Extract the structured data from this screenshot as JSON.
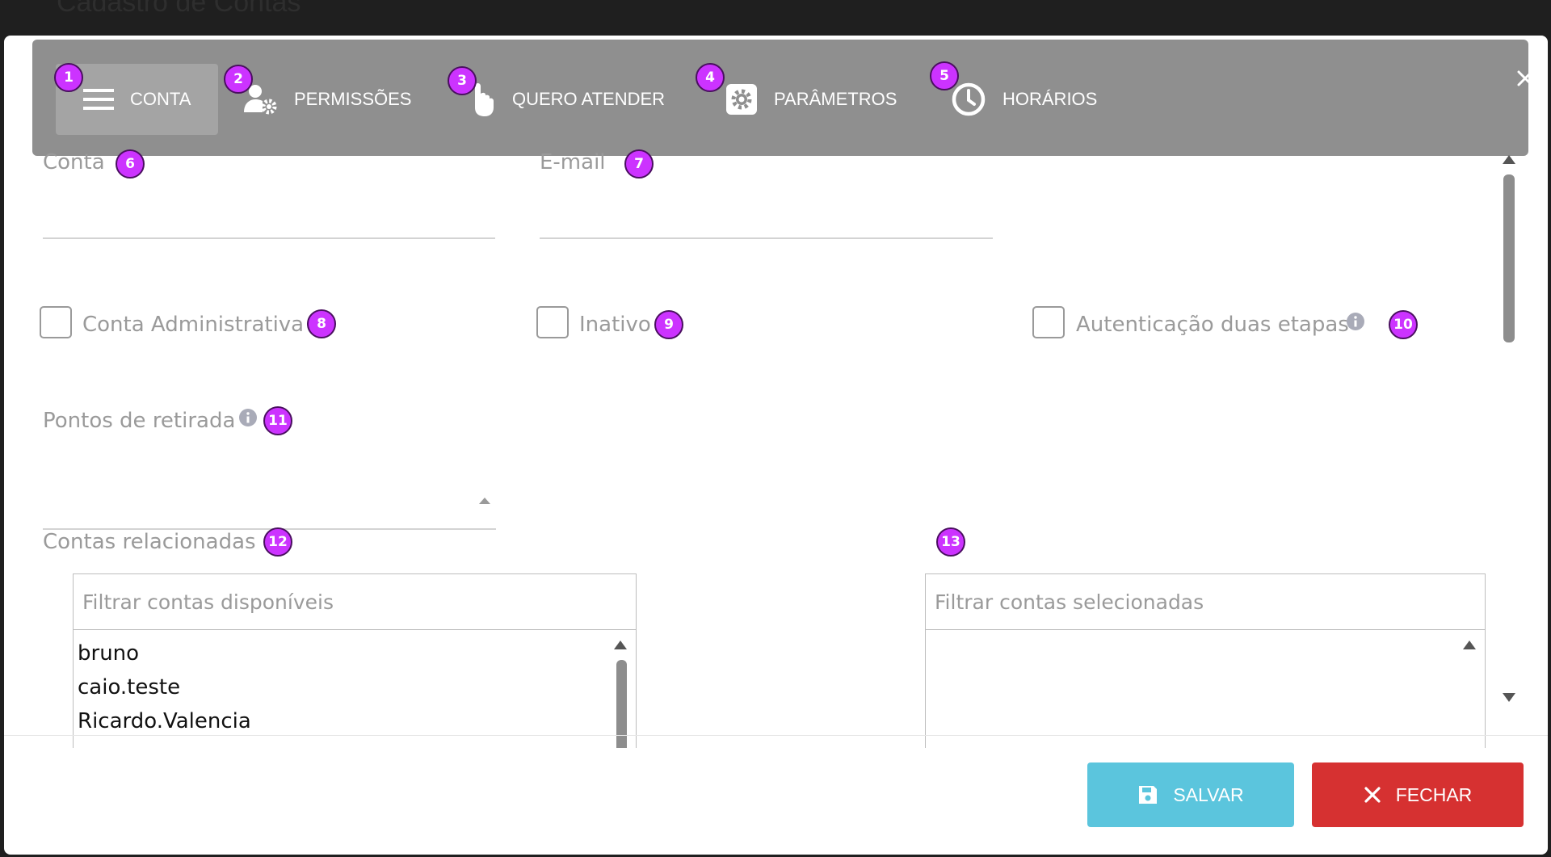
{
  "background": {
    "title": "Cadastro de Contas"
  },
  "tabs": [
    {
      "label": "CONTA",
      "icon": "menu-icon",
      "badge": "1"
    },
    {
      "label": "PERMISSÕES",
      "icon": "user-gear-icon",
      "badge": "2"
    },
    {
      "label": "QUERO ATENDER",
      "icon": "hand-pointer-icon",
      "badge": "3"
    },
    {
      "label": "PARÂMETROS",
      "icon": "gear-icon",
      "badge": "4"
    },
    {
      "label": "HORÁRIOS",
      "icon": "clock-icon",
      "badge": "5"
    }
  ],
  "form": {
    "conta": {
      "label": "Conta",
      "value": "",
      "badge": "6"
    },
    "email": {
      "label": "E-mail",
      "value": "",
      "badge": "7"
    },
    "conta_administrativa": {
      "label": "Conta Administrativa",
      "checked": false,
      "badge": "8"
    },
    "inativo": {
      "label": "Inativo",
      "checked": false,
      "badge": "9"
    },
    "autenticacao": {
      "label": "Autenticação duas etapas",
      "checked": false,
      "badge": "10"
    },
    "pontos_retirada": {
      "label": "Pontos de retirada",
      "value": "",
      "badge": "11"
    },
    "contas_relacionadas": {
      "label": "Contas relacionadas",
      "badge_left": "12",
      "badge_right": "13",
      "available_filter_placeholder": "Filtrar contas disponíveis",
      "selected_filter_placeholder": "Filtrar contas selecionadas",
      "available_items": [
        "bruno",
        "caio.teste",
        "Ricardo.Valencia"
      ],
      "selected_items": []
    }
  },
  "footer": {
    "save_label": "SALVAR",
    "close_label": "FECHAR"
  },
  "colors": {
    "tabbar": "#8f8f8f",
    "badge": "#cc33ff",
    "save": "#5bc5dd",
    "close": "#d63131"
  }
}
